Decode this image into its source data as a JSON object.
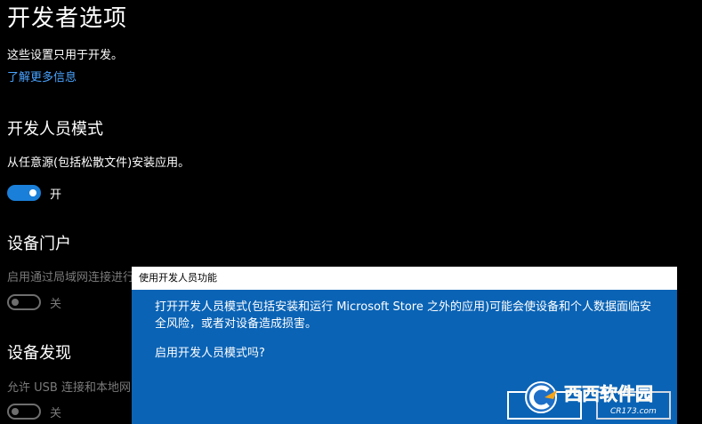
{
  "header": {
    "title": "开发者选项",
    "description": "这些设置只用于开发。",
    "learn_more": "了解更多信息"
  },
  "developer_mode": {
    "title": "开发人员模式",
    "description": "从任意源(包括松散文件)安装应用。",
    "toggle_state_label": "开",
    "enabled": true
  },
  "device_portal": {
    "title": "设备门户",
    "description": "启用通过局域网连接进行",
    "toggle_state_label": "关",
    "enabled": false
  },
  "device_discovery": {
    "title": "设备发现",
    "description": "允许 USB 连接和本地网",
    "toggle_state_label": "关",
    "enabled": false
  },
  "dialog": {
    "title": "使用开发人员功能",
    "message": "打开开发人员模式(包括安装和运行 Microsoft Store 之外的应用)可能会使设备和个人数据面临安全风险，或者对设备造成损害。",
    "question": "启用开发人员模式吗?",
    "yes_label": "",
    "no_label": ""
  },
  "watermark": {
    "brand": "西西软件园",
    "site": "CR173.com"
  },
  "colors": {
    "background": "#000000",
    "accent": "#1a7fd8",
    "link": "#4aa3ff",
    "dialog_background": "#0a63b5",
    "dim_text": "#7a7a7a"
  }
}
